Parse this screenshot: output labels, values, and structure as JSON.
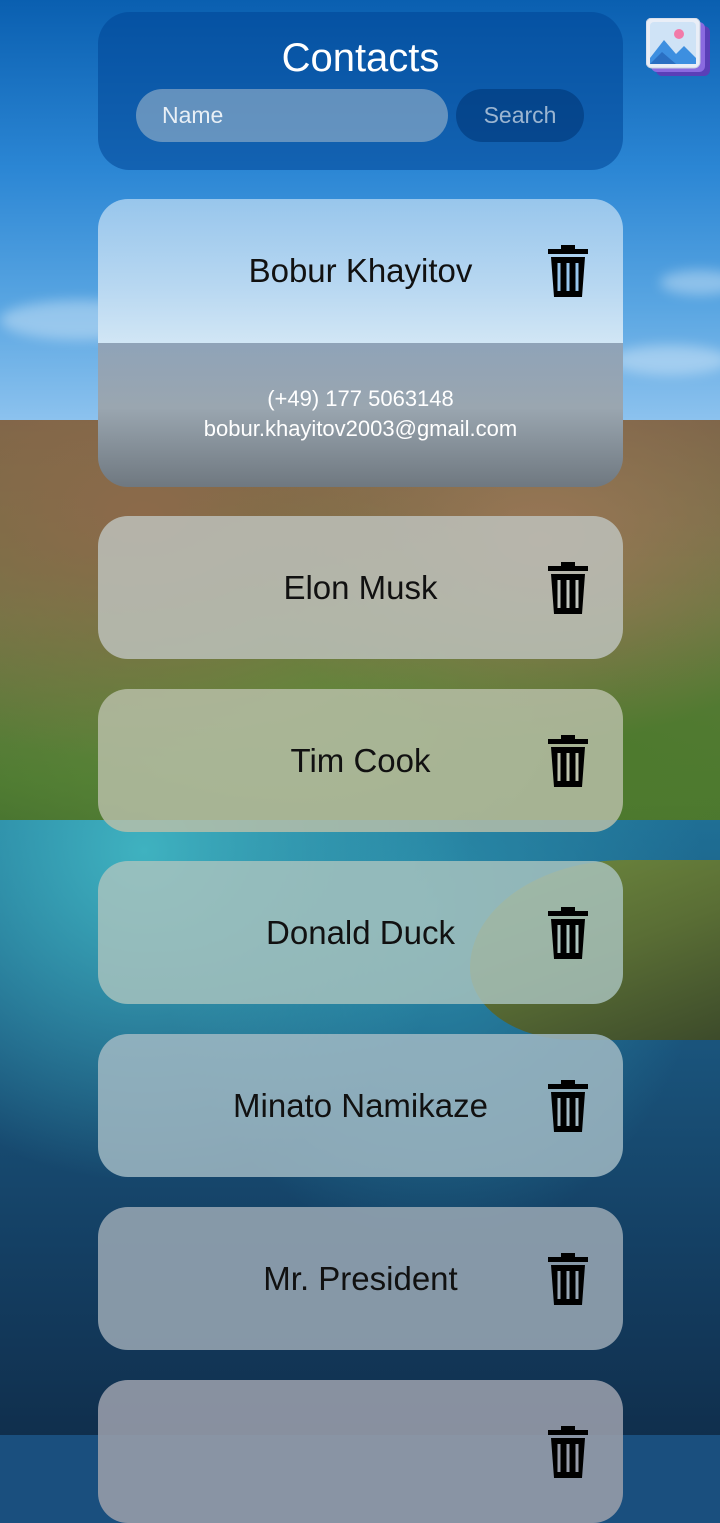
{
  "header": {
    "title": "Contacts",
    "name_placeholder": "Name",
    "search_label": "Search"
  },
  "contacts": [
    {
      "name": "Bobur Khayitov",
      "phone": "(+49) 177 5063148",
      "email": "bobur.khayitov2003@gmail.com",
      "expanded": true
    },
    {
      "name": "Elon Musk"
    },
    {
      "name": "Tim Cook"
    },
    {
      "name": "Donald Duck"
    },
    {
      "name": "Minato Namikaze"
    },
    {
      "name": "Mr. President"
    },
    {
      "name": ""
    }
  ],
  "icons": {
    "trash": "trash-icon",
    "gallery": "gallery-icon"
  }
}
